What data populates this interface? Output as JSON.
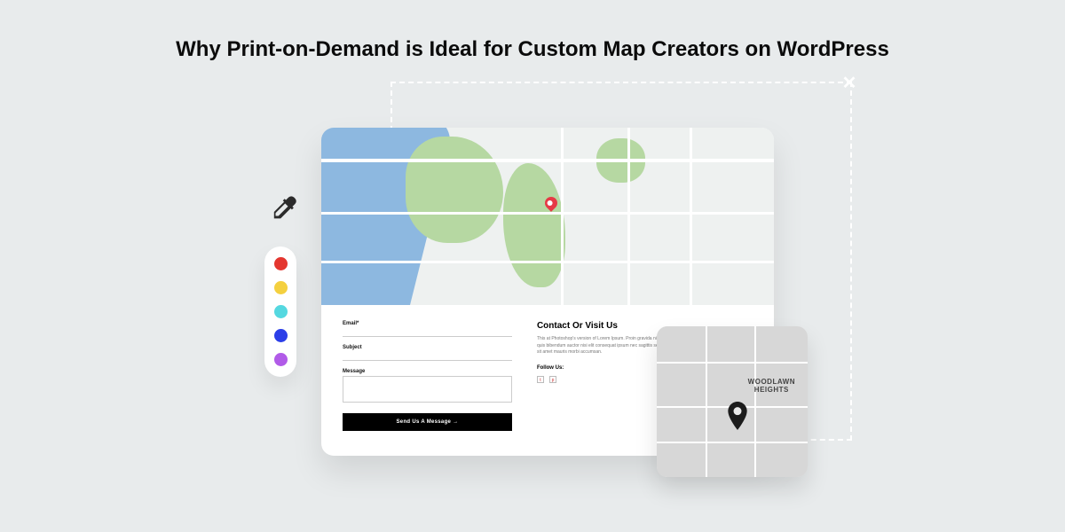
{
  "headline": "Why Print-on-Demand is Ideal for Custom Map Creators on WordPress",
  "palette": {
    "colors": [
      "#e4362f",
      "#f4d03f",
      "#55d8e0",
      "#2b3ee8",
      "#b15be8"
    ]
  },
  "form": {
    "email_label": "Email*",
    "subject_label": "Subject",
    "message_label": "Message",
    "submit_label": "Send Us A Message →"
  },
  "contact": {
    "title": "Contact Or Visit Us",
    "blurb": "This at Photoshop's version of Lorem Ipsum. Proin gravida nibh vel velit auctor aliquenean sollicitudin, lorem quis bibendum auctor nisi elit consequat ipsum nec sagittis sem nibh id elit duis sed nibh vulputate cursus a sit amet mauris morbi accumsan.",
    "follow_label": "Follow Us:",
    "social": [
      "t",
      "p"
    ]
  },
  "thumbnail": {
    "neighborhood_line1": "WOODLAWN",
    "neighborhood_line2": "HEIGHTS"
  }
}
